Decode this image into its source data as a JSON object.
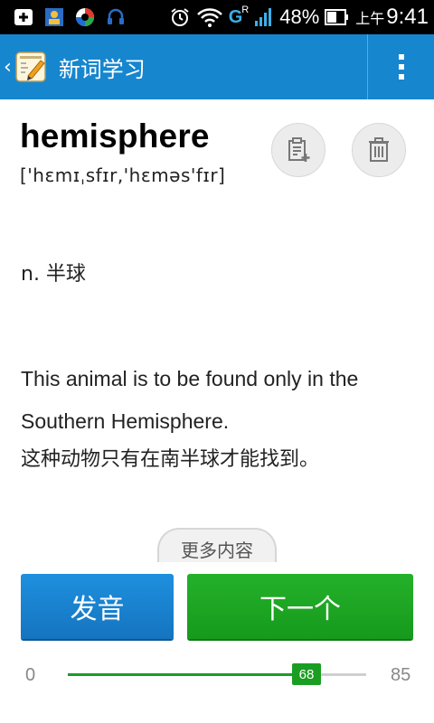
{
  "status_bar": {
    "signal_label": "G",
    "signal_sup": "R",
    "battery": "48%",
    "time_prefix": "上午",
    "time": "9:41",
    "left_icons": [
      "notification-icon",
      "contacts-icon",
      "sync-app-icon",
      "headset-icon"
    ],
    "right_icons": [
      "alarm-icon",
      "wifi-icon",
      "signal-icon",
      "battery-icon"
    ]
  },
  "app_bar": {
    "title": "新词学习",
    "background": "#1686cf"
  },
  "word": {
    "headword": "hemisphere",
    "phonetic": "['hɛmɪˌsfɪr,'hɛməs'fɪr]",
    "definition": "n. 半球",
    "example_en": "This animal is to be found only in the Southern Hemisphere.",
    "example_cn": "这种动物只有在南半球才能找到。"
  },
  "actions": {
    "more": "更多内容",
    "speak": "发音",
    "next": "下一个",
    "speak_color": "#1a82cf",
    "next_color": "#1fa824"
  },
  "progress": {
    "min": "0",
    "max": "85",
    "current": "68",
    "value": 68,
    "total": 85,
    "color": "#1a9e22"
  }
}
